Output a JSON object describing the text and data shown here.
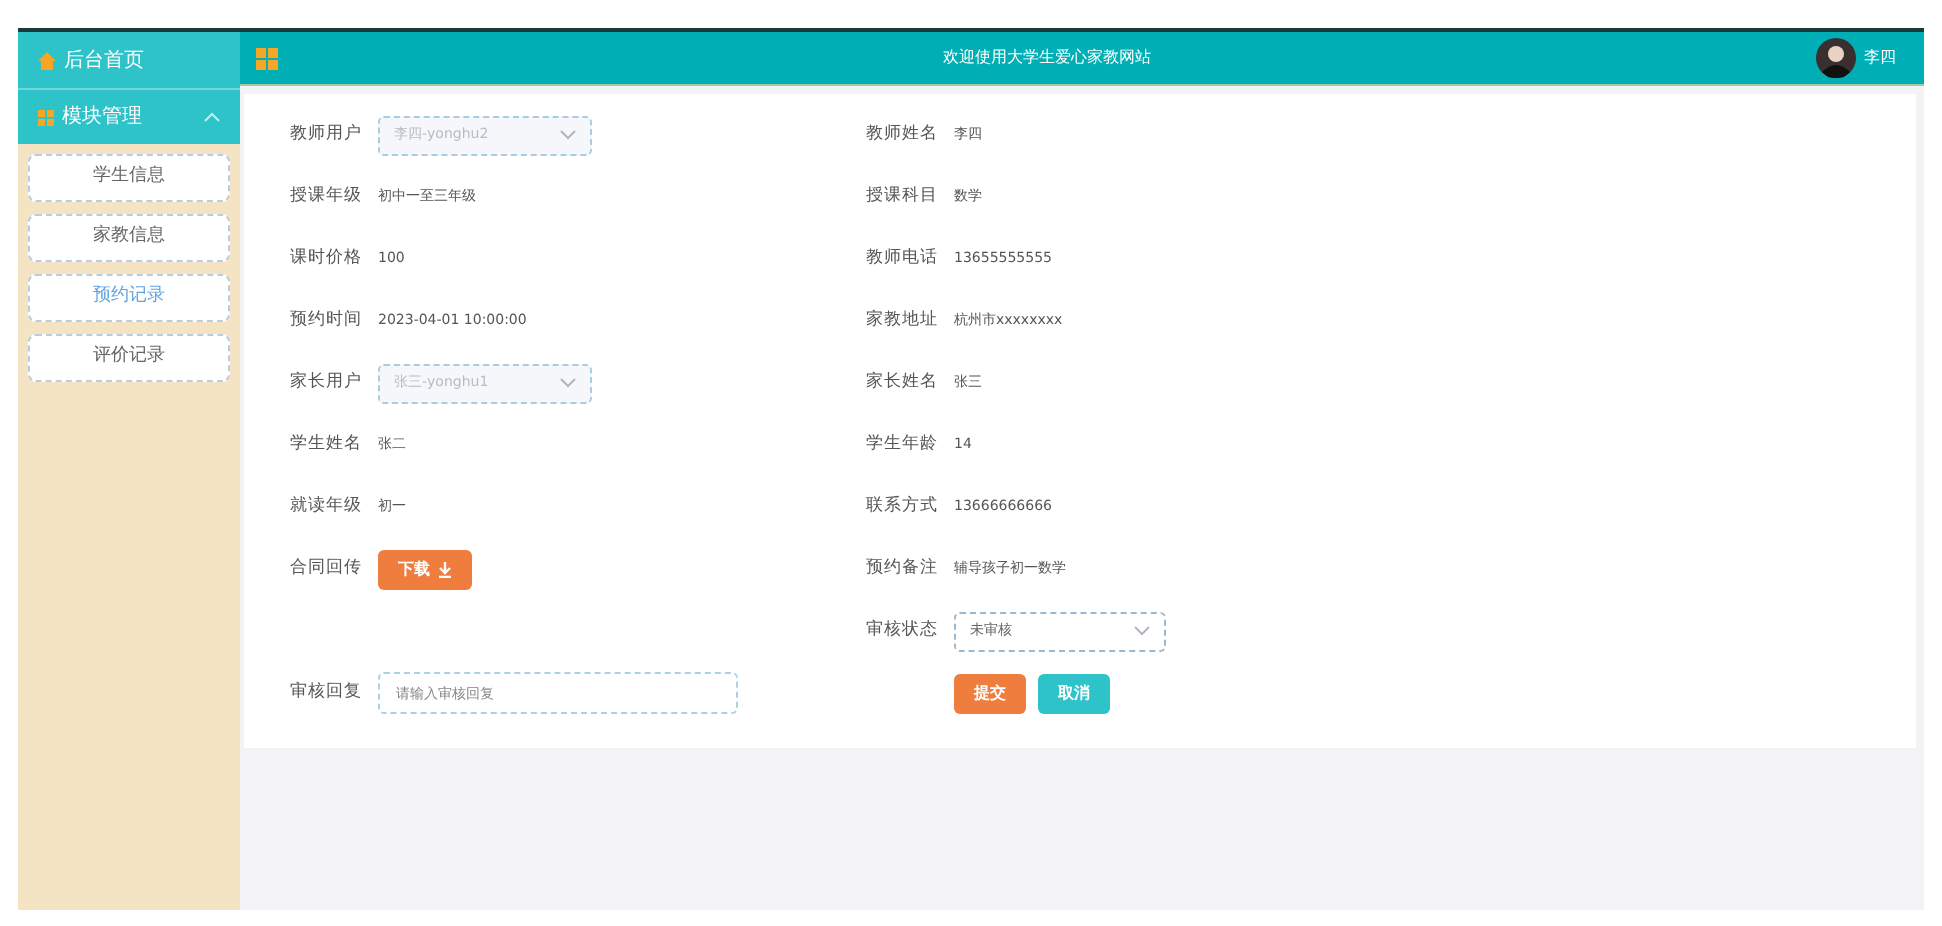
{
  "sidebar": {
    "items": [
      {
        "label": "后台首页"
      },
      {
        "label": "模块管理",
        "expanded": true,
        "children": [
          {
            "label": "学生信息",
            "selected": false
          },
          {
            "label": "家教信息",
            "selected": false
          },
          {
            "label": "预约记录",
            "selected": true
          },
          {
            "label": "评价记录",
            "selected": false
          }
        ]
      }
    ]
  },
  "header": {
    "title": "欢迎使用大学生爱心家教网站",
    "user": "李四"
  },
  "form": {
    "rows": [
      {
        "left": {
          "kind": "select",
          "label": "教师用户",
          "value": "李四-yonghu2",
          "disabled": true
        },
        "right": {
          "kind": "text",
          "label": "教师姓名",
          "value": "李四"
        }
      },
      {
        "left": {
          "kind": "text",
          "label": "授课年级",
          "value": "初中一至三年级"
        },
        "right": {
          "kind": "text",
          "label": "授课科目",
          "value": "数学"
        }
      },
      {
        "left": {
          "kind": "text",
          "label": "课时价格",
          "value": "100"
        },
        "right": {
          "kind": "text",
          "label": "教师电话",
          "value": "13655555555"
        }
      },
      {
        "left": {
          "kind": "text",
          "label": "预约时间",
          "value": "2023-04-01 10:00:00"
        },
        "right": {
          "kind": "text",
          "label": "家教地址",
          "value": "杭州市xxxxxxxx"
        }
      },
      {
        "left": {
          "kind": "select",
          "label": "家长用户",
          "value": "张三-yonghu1",
          "disabled": true
        },
        "right": {
          "kind": "text",
          "label": "家长姓名",
          "value": "张三"
        }
      },
      {
        "left": {
          "kind": "text",
          "label": "学生姓名",
          "value": "张二"
        },
        "right": {
          "kind": "text",
          "label": "学生年龄",
          "value": "14"
        }
      },
      {
        "left": {
          "kind": "text",
          "label": "就读年级",
          "value": "初一"
        },
        "right": {
          "kind": "text",
          "label": "联系方式",
          "value": "13666666666"
        }
      },
      {
        "left": {
          "kind": "download",
          "label": "合同回传",
          "button": "下载"
        },
        "right": {
          "kind": "text",
          "label": "预约备注",
          "value": "辅导孩子初一数学"
        }
      },
      {
        "right": {
          "kind": "status",
          "label": "审核状态",
          "value": "未审核"
        }
      },
      {
        "left": {
          "kind": "input",
          "label": "审核回复",
          "placeholder": "请输入审核回复"
        },
        "right": {
          "kind": "actions",
          "buttons": [
            "提交",
            "取消"
          ]
        }
      }
    ]
  }
}
